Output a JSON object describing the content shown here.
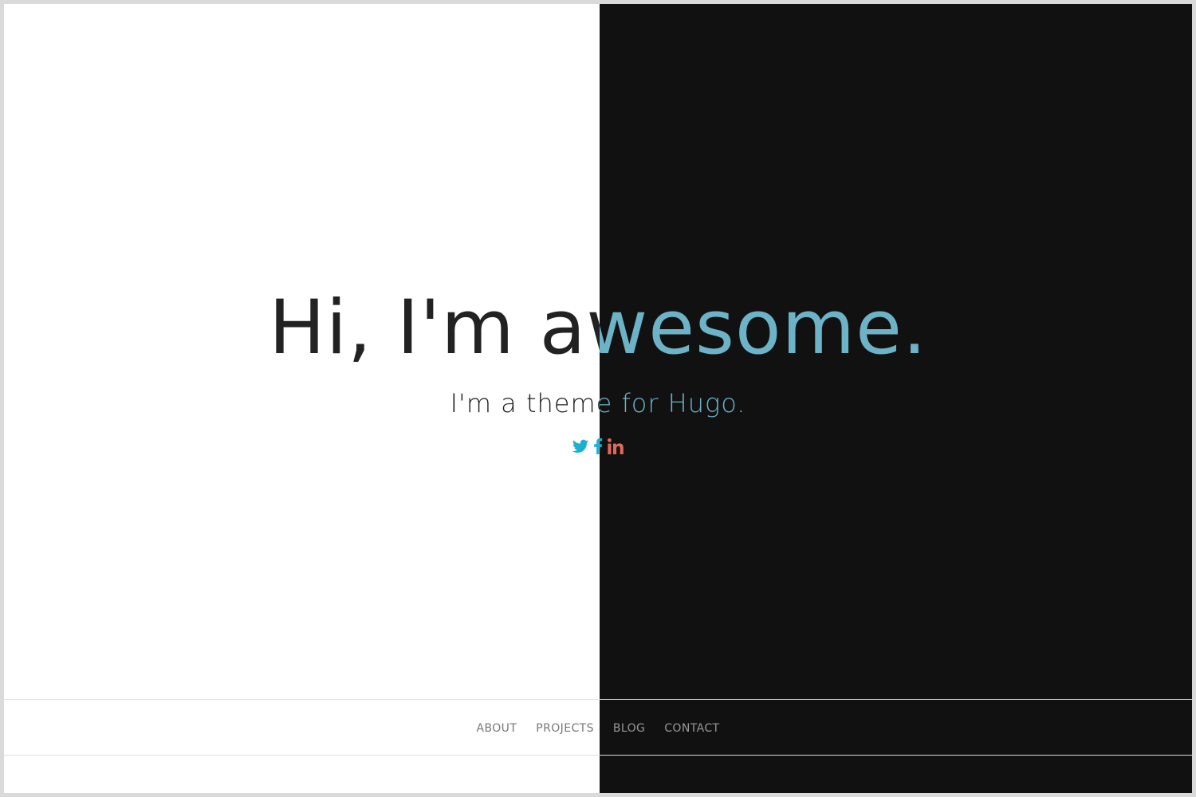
{
  "hero": {
    "title": "Hi, I'm awesome.",
    "subtitle": "I'm a theme for Hugo."
  },
  "social": [
    {
      "name": "twitter-icon",
      "color": "#1cb0d0"
    },
    {
      "name": "facebook-icon",
      "color": "#1cb0d0"
    },
    {
      "name": "linkedin-icon",
      "color": "#e06a59"
    }
  ],
  "nav": {
    "items": [
      {
        "label": "ABOUT"
      },
      {
        "label": "PROJECTS"
      },
      {
        "label": "BLOG"
      },
      {
        "label": "CONTACT"
      }
    ]
  },
  "colors": {
    "light_bg": "#ffffff",
    "dark_bg": "#111111",
    "light_text": "#222222",
    "dark_text": "#6db3c7",
    "nav_text_light": "#777777",
    "nav_text_dark": "#999999"
  }
}
